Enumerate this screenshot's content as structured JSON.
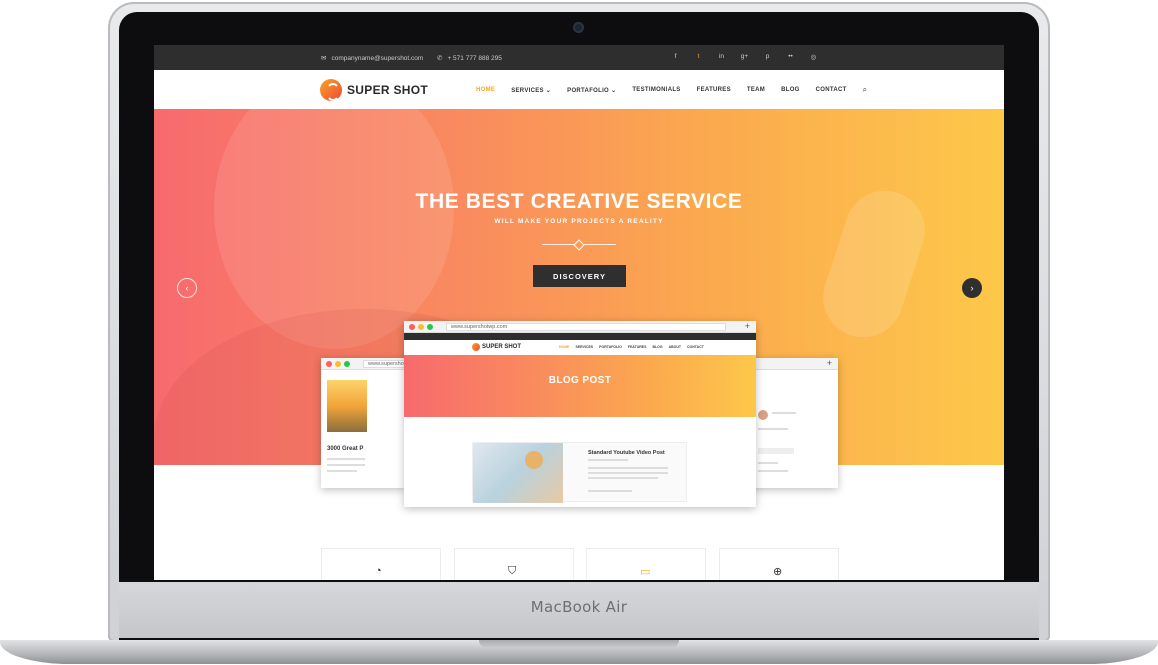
{
  "device": {
    "brand_label": "MacBook Air"
  },
  "topbar": {
    "email": "companyname@supershot.com",
    "phone": "+ 571 777 888 295",
    "social_icons": [
      "facebook-icon",
      "twitter-icon",
      "linkedin-icon",
      "google-plus-icon",
      "pinterest-icon",
      "flickr-icon",
      "dribbble-icon"
    ],
    "social_glyphs": [
      "f",
      "t",
      "in",
      "g+",
      "p",
      "••",
      "◎"
    ]
  },
  "nav": {
    "logo_text": "SUPER SHOT",
    "items": [
      {
        "label": "HOME",
        "active": true
      },
      {
        "label": "SERVICES ⌄"
      },
      {
        "label": "PORTAFOLIO ⌄"
      },
      {
        "label": "TESTIMONIALS"
      },
      {
        "label": "FEATURES"
      },
      {
        "label": "TEAM"
      },
      {
        "label": "BLOG"
      },
      {
        "label": "CONTACT"
      }
    ],
    "search_glyph": "⌕"
  },
  "hero": {
    "title": "THE BEST CREATIVE SERVICE",
    "subtitle": "WILL MAKE YOUR PROJECTS A REALITY",
    "cta_label": "DISCOVERY",
    "prev_glyph": "‹",
    "next_glyph": "›"
  },
  "mockups": {
    "main_url": "www.supershotwp.com",
    "left_url": "www.supershotwp.com",
    "logo_text": "SUPER SHOT",
    "menu": [
      "HOME",
      "SERVICES",
      "PORTAFOLIO",
      "FEATURES",
      "BLOG",
      "ABOUT",
      "CONTACT"
    ],
    "hero_title": "BLOG POST",
    "post_title": "Standard Youtube Video Post",
    "left_post_title": "3000 Great P",
    "plus_glyph": "+"
  },
  "features": {
    "icons": [
      "pie-chart-icon",
      "shield-icon",
      "laptop-icon",
      "lifebuoy-icon"
    ],
    "glyphs": [
      "◔",
      "⛉",
      "▭",
      "⊕"
    ]
  },
  "colors": {
    "accent": "#f5a623",
    "hero_gradient_start": "#f76a6e",
    "hero_gradient_end": "#fdc84a",
    "topbar_bg": "#2e2e2e",
    "button_bg": "#2f2f2f"
  }
}
